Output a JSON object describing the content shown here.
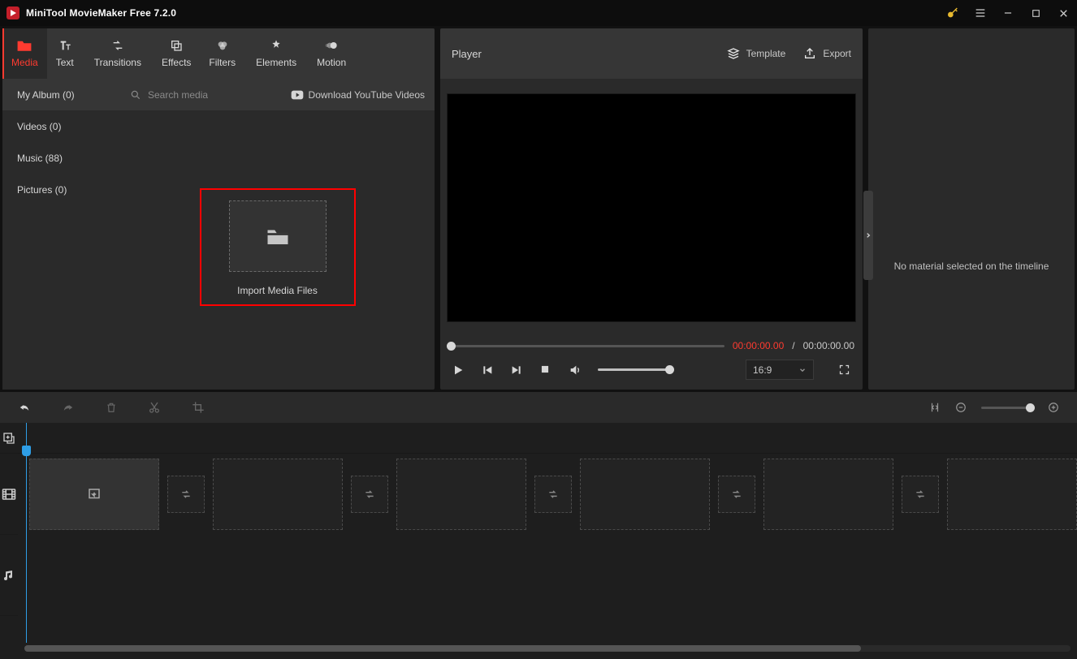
{
  "app": {
    "title": "MiniTool MovieMaker Free 7.2.0"
  },
  "tabs": {
    "media": "Media",
    "text": "Text",
    "transitions": "Transitions",
    "effects": "Effects",
    "filters": "Filters",
    "elements": "Elements",
    "motion": "Motion"
  },
  "sidebar": {
    "album": "My Album (0)",
    "videos": "Videos (0)",
    "music": "Music (88)",
    "pictures": "Pictures (0)"
  },
  "media": {
    "search_placeholder": "Search media",
    "yt": "Download YouTube Videos",
    "import": "Import Media Files"
  },
  "player": {
    "title": "Player",
    "template": "Template",
    "export": "Export",
    "current": "00:00:00.00",
    "sep": "/",
    "total": "00:00:00.00",
    "ratio": "16:9"
  },
  "properties": {
    "empty": "No material selected on the timeline"
  }
}
